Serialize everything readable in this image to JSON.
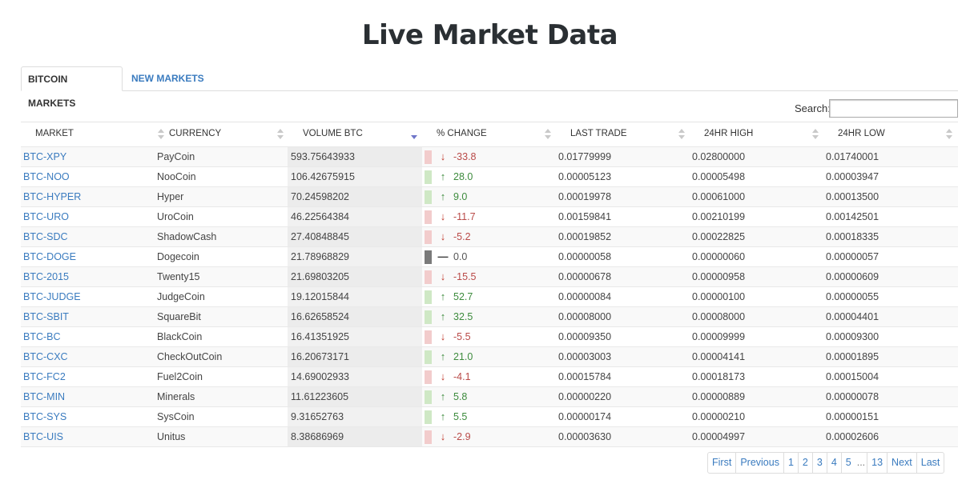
{
  "page": {
    "title": "Live Market Data"
  },
  "tabs": [
    {
      "label": "BITCOIN MARKETS",
      "active": true
    },
    {
      "label": "NEW MARKETS",
      "active": false
    }
  ],
  "search": {
    "label": "Search:",
    "value": ""
  },
  "columns": [
    "MARKET",
    "CURRENCY",
    "VOLUME BTC",
    "% CHANGE",
    "LAST TRADE",
    "24HR HIGH",
    "24HR LOW"
  ],
  "sorted_column": "VOLUME BTC",
  "sort_direction": "desc",
  "colors": {
    "link": "#3a7bbf",
    "up": "#3d8b3d",
    "down": "#b94a48",
    "up_bar": "#cfe8c5",
    "down_bar": "#f2cccc",
    "flat_bar": "#7a7a7a"
  },
  "rows": [
    {
      "market": "BTC-XPY",
      "currency": "PayCoin",
      "volume": "593.75643933",
      "change": "-33.8",
      "dir": "down",
      "last": "0.01779999",
      "high": "0.02800000",
      "low": "0.01740001"
    },
    {
      "market": "BTC-NOO",
      "currency": "NooCoin",
      "volume": "106.42675915",
      "change": "28.0",
      "dir": "up",
      "last": "0.00005123",
      "high": "0.00005498",
      "low": "0.00003947"
    },
    {
      "market": "BTC-HYPER",
      "currency": "Hyper",
      "volume": "70.24598202",
      "change": "9.0",
      "dir": "up",
      "last": "0.00019978",
      "high": "0.00061000",
      "low": "0.00013500"
    },
    {
      "market": "BTC-URO",
      "currency": "UroCoin",
      "volume": "46.22564384",
      "change": "-11.7",
      "dir": "down",
      "last": "0.00159841",
      "high": "0.00210199",
      "low": "0.00142501"
    },
    {
      "market": "BTC-SDC",
      "currency": "ShadowCash",
      "volume": "27.40848845",
      "change": "-5.2",
      "dir": "down",
      "last": "0.00019852",
      "high": "0.00022825",
      "low": "0.00018335"
    },
    {
      "market": "BTC-DOGE",
      "currency": "Dogecoin",
      "volume": "21.78968829",
      "change": "0.0",
      "dir": "flat",
      "last": "0.00000058",
      "high": "0.00000060",
      "low": "0.00000057"
    },
    {
      "market": "BTC-2015",
      "currency": "Twenty15",
      "volume": "21.69803205",
      "change": "-15.5",
      "dir": "down",
      "last": "0.00000678",
      "high": "0.00000958",
      "low": "0.00000609"
    },
    {
      "market": "BTC-JUDGE",
      "currency": "JudgeCoin",
      "volume": "19.12015844",
      "change": "52.7",
      "dir": "up",
      "last": "0.00000084",
      "high": "0.00000100",
      "low": "0.00000055"
    },
    {
      "market": "BTC-SBIT",
      "currency": "SquareBit",
      "volume": "16.62658524",
      "change": "32.5",
      "dir": "up",
      "last": "0.00008000",
      "high": "0.00008000",
      "low": "0.00004401"
    },
    {
      "market": "BTC-BC",
      "currency": "BlackCoin",
      "volume": "16.41351925",
      "change": "-5.5",
      "dir": "down",
      "last": "0.00009350",
      "high": "0.00009999",
      "low": "0.00009300"
    },
    {
      "market": "BTC-CXC",
      "currency": "CheckOutCoin",
      "volume": "16.20673171",
      "change": "21.0",
      "dir": "up",
      "last": "0.00003003",
      "high": "0.00004141",
      "low": "0.00001895"
    },
    {
      "market": "BTC-FC2",
      "currency": "Fuel2Coin",
      "volume": "14.69002933",
      "change": "-4.1",
      "dir": "down",
      "last": "0.00015784",
      "high": "0.00018173",
      "low": "0.00015004"
    },
    {
      "market": "BTC-MIN",
      "currency": "Minerals",
      "volume": "11.61223605",
      "change": "5.8",
      "dir": "up",
      "last": "0.00000220",
      "high": "0.00000889",
      "low": "0.00000078"
    },
    {
      "market": "BTC-SYS",
      "currency": "SysCoin",
      "volume": "9.31652763",
      "change": "5.5",
      "dir": "up",
      "last": "0.00000174",
      "high": "0.00000210",
      "low": "0.00000151"
    },
    {
      "market": "BTC-UIS",
      "currency": "Unitus",
      "volume": "8.38686969",
      "change": "-2.9",
      "dir": "down",
      "last": "0.00003630",
      "high": "0.00004997",
      "low": "0.00002606"
    }
  ],
  "pagination": [
    "First",
    "Previous",
    "1",
    "2",
    "3",
    "4",
    "5",
    "...",
    "13",
    "Next",
    "Last"
  ]
}
